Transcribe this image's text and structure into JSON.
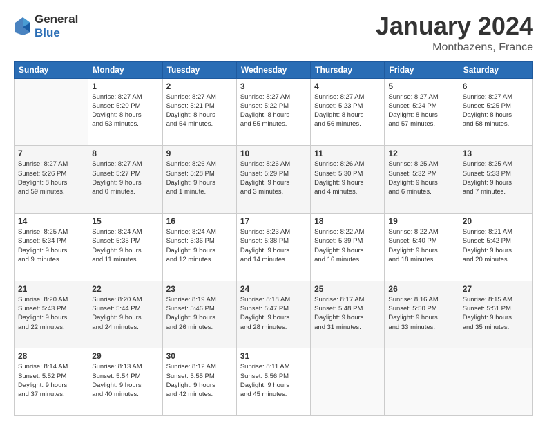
{
  "header": {
    "logo_general": "General",
    "logo_blue": "Blue",
    "title": "January 2024",
    "location": "Montbazens, France"
  },
  "days_of_week": [
    "Sunday",
    "Monday",
    "Tuesday",
    "Wednesday",
    "Thursday",
    "Friday",
    "Saturday"
  ],
  "weeks": [
    [
      {
        "day": "",
        "empty": true
      },
      {
        "day": "1",
        "sunrise": "Sunrise: 8:27 AM",
        "sunset": "Sunset: 5:20 PM",
        "daylight": "Daylight: 8 hours and 53 minutes."
      },
      {
        "day": "2",
        "sunrise": "Sunrise: 8:27 AM",
        "sunset": "Sunset: 5:21 PM",
        "daylight": "Daylight: 8 hours and 54 minutes."
      },
      {
        "day": "3",
        "sunrise": "Sunrise: 8:27 AM",
        "sunset": "Sunset: 5:22 PM",
        "daylight": "Daylight: 8 hours and 55 minutes."
      },
      {
        "day": "4",
        "sunrise": "Sunrise: 8:27 AM",
        "sunset": "Sunset: 5:23 PM",
        "daylight": "Daylight: 8 hours and 56 minutes."
      },
      {
        "day": "5",
        "sunrise": "Sunrise: 8:27 AM",
        "sunset": "Sunset: 5:24 PM",
        "daylight": "Daylight: 8 hours and 57 minutes."
      },
      {
        "day": "6",
        "sunrise": "Sunrise: 8:27 AM",
        "sunset": "Sunset: 5:25 PM",
        "daylight": "Daylight: 8 hours and 58 minutes."
      }
    ],
    [
      {
        "day": "7",
        "sunrise": "Sunrise: 8:27 AM",
        "sunset": "Sunset: 5:26 PM",
        "daylight": "Daylight: 8 hours and 59 minutes."
      },
      {
        "day": "8",
        "sunrise": "Sunrise: 8:27 AM",
        "sunset": "Sunset: 5:27 PM",
        "daylight": "Daylight: 9 hours and 0 minutes."
      },
      {
        "day": "9",
        "sunrise": "Sunrise: 8:26 AM",
        "sunset": "Sunset: 5:28 PM",
        "daylight": "Daylight: 9 hours and 1 minute."
      },
      {
        "day": "10",
        "sunrise": "Sunrise: 8:26 AM",
        "sunset": "Sunset: 5:29 PM",
        "daylight": "Daylight: 9 hours and 3 minutes."
      },
      {
        "day": "11",
        "sunrise": "Sunrise: 8:26 AM",
        "sunset": "Sunset: 5:30 PM",
        "daylight": "Daylight: 9 hours and 4 minutes."
      },
      {
        "day": "12",
        "sunrise": "Sunrise: 8:25 AM",
        "sunset": "Sunset: 5:32 PM",
        "daylight": "Daylight: 9 hours and 6 minutes."
      },
      {
        "day": "13",
        "sunrise": "Sunrise: 8:25 AM",
        "sunset": "Sunset: 5:33 PM",
        "daylight": "Daylight: 9 hours and 7 minutes."
      }
    ],
    [
      {
        "day": "14",
        "sunrise": "Sunrise: 8:25 AM",
        "sunset": "Sunset: 5:34 PM",
        "daylight": "Daylight: 9 hours and 9 minutes."
      },
      {
        "day": "15",
        "sunrise": "Sunrise: 8:24 AM",
        "sunset": "Sunset: 5:35 PM",
        "daylight": "Daylight: 9 hours and 11 minutes."
      },
      {
        "day": "16",
        "sunrise": "Sunrise: 8:24 AM",
        "sunset": "Sunset: 5:36 PM",
        "daylight": "Daylight: 9 hours and 12 minutes."
      },
      {
        "day": "17",
        "sunrise": "Sunrise: 8:23 AM",
        "sunset": "Sunset: 5:38 PM",
        "daylight": "Daylight: 9 hours and 14 minutes."
      },
      {
        "day": "18",
        "sunrise": "Sunrise: 8:22 AM",
        "sunset": "Sunset: 5:39 PM",
        "daylight": "Daylight: 9 hours and 16 minutes."
      },
      {
        "day": "19",
        "sunrise": "Sunrise: 8:22 AM",
        "sunset": "Sunset: 5:40 PM",
        "daylight": "Daylight: 9 hours and 18 minutes."
      },
      {
        "day": "20",
        "sunrise": "Sunrise: 8:21 AM",
        "sunset": "Sunset: 5:42 PM",
        "daylight": "Daylight: 9 hours and 20 minutes."
      }
    ],
    [
      {
        "day": "21",
        "sunrise": "Sunrise: 8:20 AM",
        "sunset": "Sunset: 5:43 PM",
        "daylight": "Daylight: 9 hours and 22 minutes."
      },
      {
        "day": "22",
        "sunrise": "Sunrise: 8:20 AM",
        "sunset": "Sunset: 5:44 PM",
        "daylight": "Daylight: 9 hours and 24 minutes."
      },
      {
        "day": "23",
        "sunrise": "Sunrise: 8:19 AM",
        "sunset": "Sunset: 5:46 PM",
        "daylight": "Daylight: 9 hours and 26 minutes."
      },
      {
        "day": "24",
        "sunrise": "Sunrise: 8:18 AM",
        "sunset": "Sunset: 5:47 PM",
        "daylight": "Daylight: 9 hours and 28 minutes."
      },
      {
        "day": "25",
        "sunrise": "Sunrise: 8:17 AM",
        "sunset": "Sunset: 5:48 PM",
        "daylight": "Daylight: 9 hours and 31 minutes."
      },
      {
        "day": "26",
        "sunrise": "Sunrise: 8:16 AM",
        "sunset": "Sunset: 5:50 PM",
        "daylight": "Daylight: 9 hours and 33 minutes."
      },
      {
        "day": "27",
        "sunrise": "Sunrise: 8:15 AM",
        "sunset": "Sunset: 5:51 PM",
        "daylight": "Daylight: 9 hours and 35 minutes."
      }
    ],
    [
      {
        "day": "28",
        "sunrise": "Sunrise: 8:14 AM",
        "sunset": "Sunset: 5:52 PM",
        "daylight": "Daylight: 9 hours and 37 minutes."
      },
      {
        "day": "29",
        "sunrise": "Sunrise: 8:13 AM",
        "sunset": "Sunset: 5:54 PM",
        "daylight": "Daylight: 9 hours and 40 minutes."
      },
      {
        "day": "30",
        "sunrise": "Sunrise: 8:12 AM",
        "sunset": "Sunset: 5:55 PM",
        "daylight": "Daylight: 9 hours and 42 minutes."
      },
      {
        "day": "31",
        "sunrise": "Sunrise: 8:11 AM",
        "sunset": "Sunset: 5:56 PM",
        "daylight": "Daylight: 9 hours and 45 minutes."
      },
      {
        "day": "",
        "empty": true
      },
      {
        "day": "",
        "empty": true
      },
      {
        "day": "",
        "empty": true
      }
    ]
  ]
}
